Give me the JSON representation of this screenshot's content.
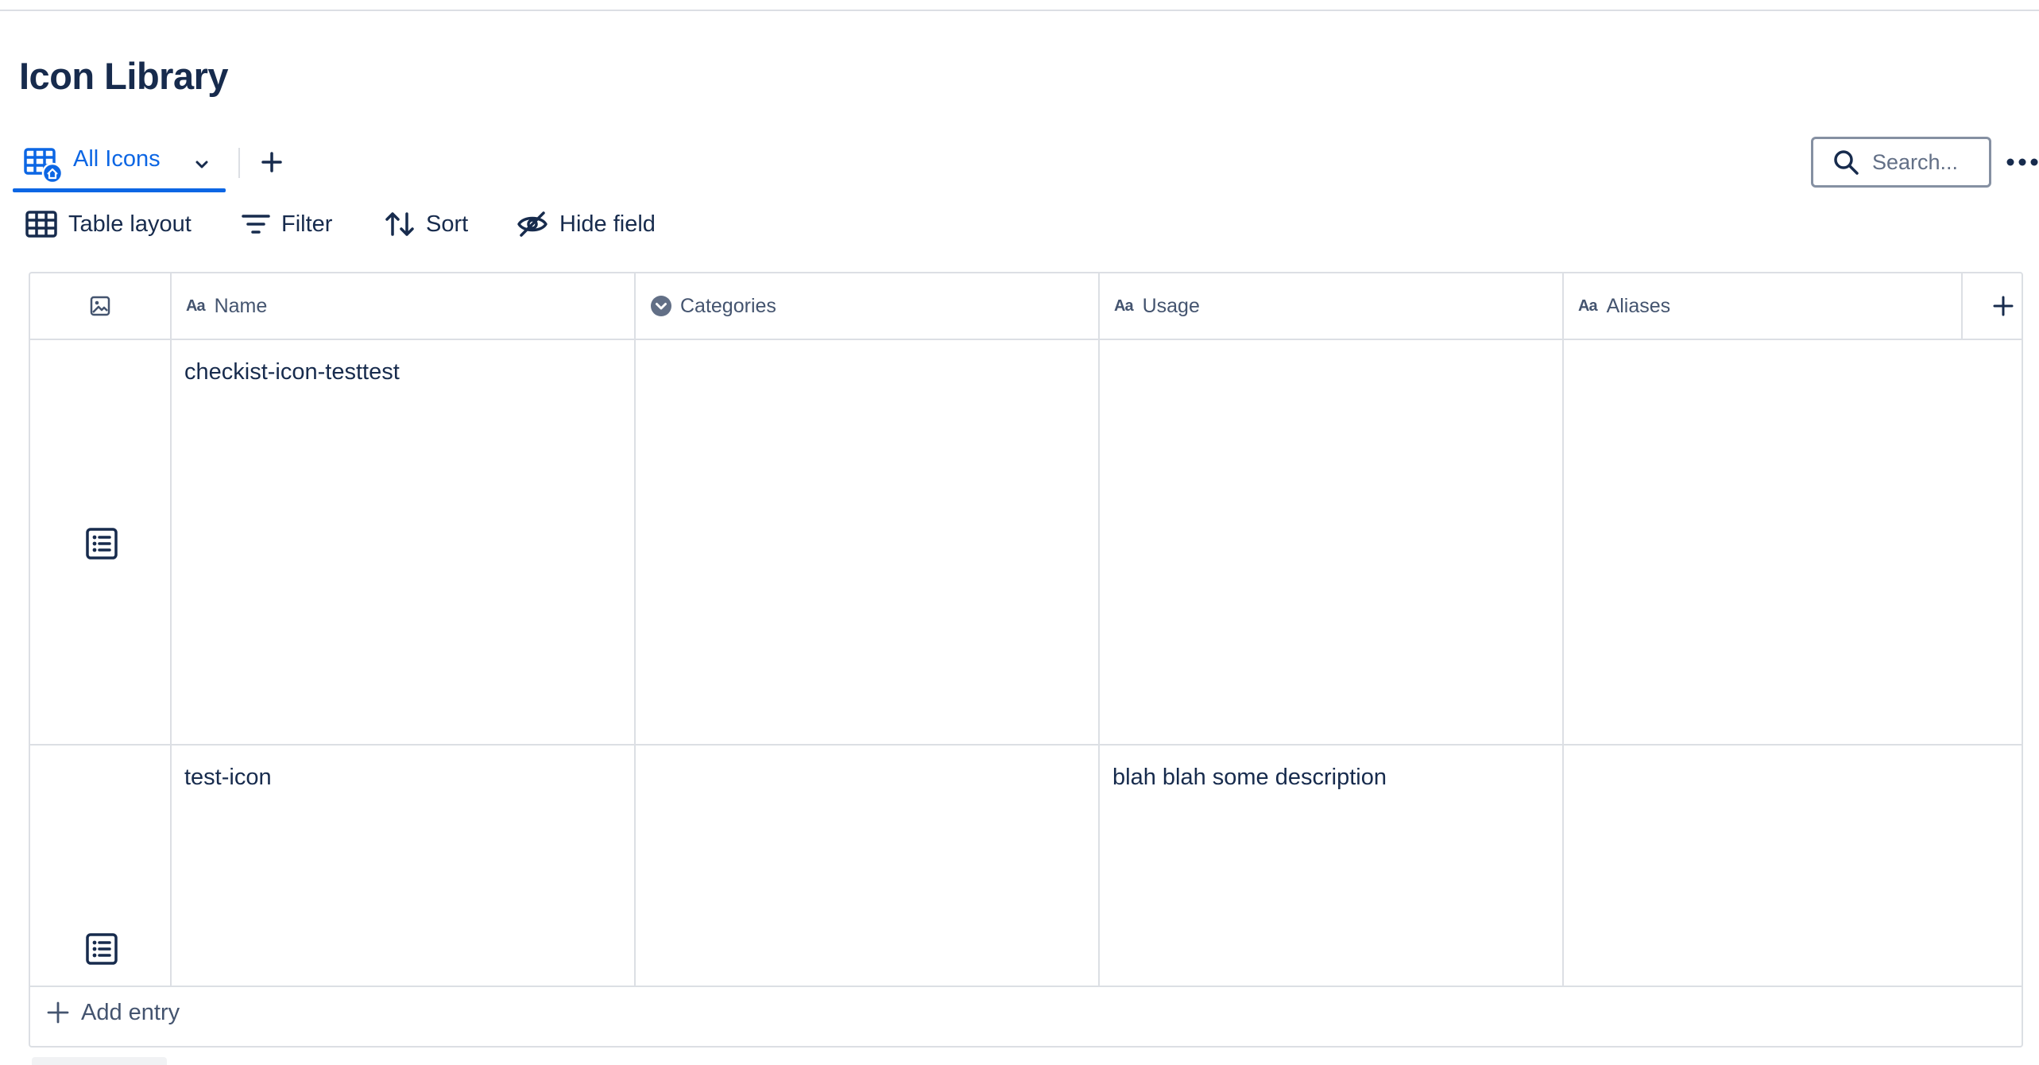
{
  "page": {
    "title": "Icon Library"
  },
  "views": {
    "active_tab_label": "All Icons",
    "active_tab_icon": "table-view-icon",
    "add_view_icon": "plus-icon"
  },
  "search": {
    "placeholder": "Search...",
    "icon": "search-icon"
  },
  "more_icon": "more-horizontal-icon",
  "toolbar": {
    "layout_label": "Table layout",
    "filter_label": "Filter",
    "sort_label": "Sort",
    "hide_field_label": "Hide field"
  },
  "table": {
    "columns": [
      {
        "label": "",
        "type_icon": "image-icon"
      },
      {
        "label": "Name",
        "type_icon": "text-field-icon"
      },
      {
        "label": "Categories",
        "type_icon": "select-field-icon"
      },
      {
        "label": "Usage",
        "type_icon": "text-field-icon"
      },
      {
        "label": "Aliases",
        "type_icon": "text-field-icon"
      }
    ],
    "field_type_badge": "Aa",
    "rows": [
      {
        "icon": "list-icon",
        "name": "checkist-icon-testtest",
        "categories": "",
        "usage": "",
        "aliases": ""
      },
      {
        "icon": "list-icon",
        "name": "test-icon",
        "categories": "",
        "usage": "blah blah some description",
        "aliases": ""
      }
    ],
    "add_entry_label": "Add entry"
  },
  "colors": {
    "accent": "#0c66e4",
    "text": "#172b4d",
    "subtle_text": "#44546f",
    "border": "#dcdfe4"
  }
}
